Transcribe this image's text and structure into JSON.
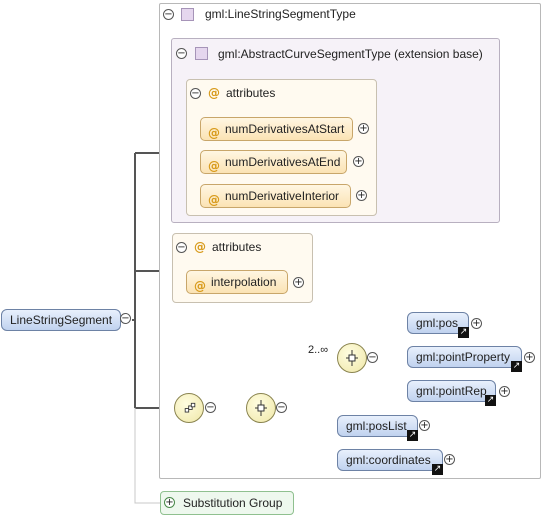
{
  "root_element": "LineStringSegment",
  "type_name": "gml:LineStringSegmentType",
  "base_type": "gml:AbstractCurveSegmentType (extension base)",
  "inherited_attributes": {
    "label": "attributes",
    "items": [
      "numDerivativesAtStart",
      "numDerivativesAtEnd",
      "numDerivativeInterior"
    ]
  },
  "own_attributes": {
    "label": "attributes",
    "items": [
      "interpolation"
    ]
  },
  "choice_occurrence": "2..∞",
  "choice_elements": [
    "gml:pos",
    "gml:pointProperty",
    "gml:pointRep"
  ],
  "other_elements": [
    "gml:posList",
    "gml:coordinates"
  ],
  "substitution_group": "Substitution Group",
  "icons": {
    "collapse": "−",
    "expand": "+",
    "attribute": "@",
    "reference": "↗"
  }
}
